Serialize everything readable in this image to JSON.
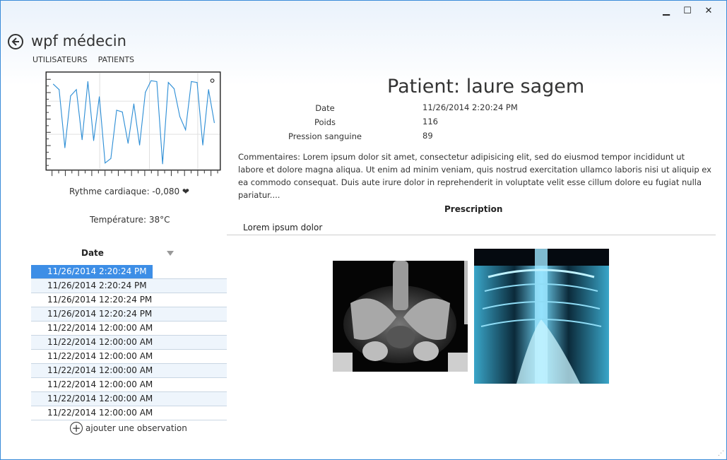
{
  "window": {
    "minimize_icon": "minimize-icon",
    "maximize_icon": "maximize-icon",
    "close_icon": "close-icon"
  },
  "app": {
    "title": "wpf médecin"
  },
  "nav": {
    "users": "UTILISATEURS",
    "patients": "PATIENTS"
  },
  "heart_rate": {
    "label": "Rythme cardiaque: -0,080 ❤"
  },
  "temperature": {
    "label": "Température: 38°C"
  },
  "chart_data": {
    "type": "line",
    "title": "",
    "xlabel": "",
    "ylabel": "",
    "x": [
      0,
      1,
      2,
      3,
      4,
      5,
      6,
      7,
      8,
      9,
      10,
      11,
      12,
      13,
      14,
      15,
      16,
      17,
      18,
      19,
      20,
      21,
      22,
      23,
      24,
      25,
      26,
      27,
      28
    ],
    "values": [
      0.93,
      0.87,
      0.22,
      0.8,
      0.87,
      0.31,
      0.96,
      0.3,
      0.79,
      0.05,
      0.1,
      0.64,
      0.62,
      0.27,
      0.71,
      0.25,
      0.84,
      0.97,
      0.96,
      0.04,
      0.95,
      0.88,
      0.57,
      0.42,
      0.96,
      0.95,
      0.25,
      0.87,
      0.5
    ],
    "ylim": [
      0,
      1
    ],
    "grid": true,
    "color": "#2f8fd6"
  },
  "grid": {
    "header": "Date",
    "rows": [
      "11/26/2014 2:20:24 PM",
      "11/26/2014 2:20:24 PM",
      "11/26/2014 12:20:24 PM",
      "11/26/2014 12:20:24 PM",
      "11/22/2014 12:00:00 AM",
      "11/22/2014 12:00:00 AM",
      "11/22/2014 12:00:00 AM",
      "11/22/2014 12:00:00 AM",
      "11/22/2014 12:00:00 AM",
      "11/22/2014 12:00:00 AM",
      "11/22/2014 12:00:00 AM"
    ]
  },
  "add_observation": {
    "label": "ajouter une observation"
  },
  "patient": {
    "title": "Patient: laure sagem",
    "date_label": "Date",
    "date_value": "11/26/2014 2:20:24 PM",
    "weight_label": "Poids",
    "weight_value": "116",
    "bp_label": "Pression sanguine",
    "bp_value": "89",
    "comments": "Commentaires: Lorem ipsum dolor sit amet, consectetur adipisicing elit, sed do eiusmod tempor incididunt ut labore et dolore magna aliqua. Ut enim ad minim veniam, quis nostrud exercitation ullamco laboris nisi ut aliquip ex ea commodo consequat. Duis aute irure dolor in reprehenderit in voluptate velit esse cillum dolore eu fugiat nulla pariatur....",
    "prescription_title": "Prescription",
    "prescription_item": "Lorem ipsum dolor"
  },
  "colors": {
    "accent": "#3d8ee6",
    "chart_line": "#2f8fd6",
    "border": "#3a8bd8"
  }
}
